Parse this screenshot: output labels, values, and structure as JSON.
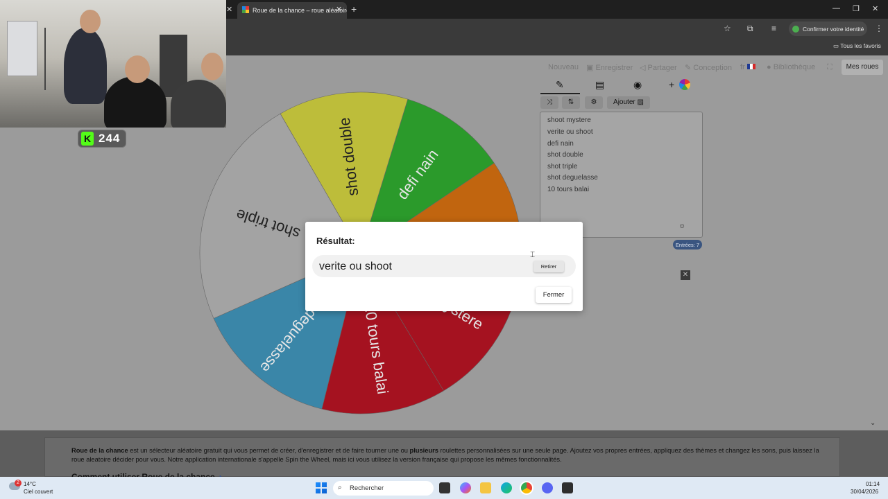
{
  "browser": {
    "tab_title": "Roue de la chance – roue aléatoire",
    "identity_button": "Confirmer votre identité",
    "bookmarks_label": "Tous les favoris"
  },
  "nav": {
    "new": "Nouveau",
    "save": "Enregistrer",
    "share": "Partager",
    "design": "Conception",
    "lang": "fr",
    "library": "Bibliothèque",
    "my_wheels": "Mes roues"
  },
  "editor": {
    "add_image_label": "Ajouter",
    "entries": [
      "shoot mystere",
      "verite ou shoot",
      "defi nain",
      "shot double",
      "shot triple",
      "shot deguelasse",
      "10 tours balai"
    ],
    "entries_count": "Entrées: 7"
  },
  "wheel": {
    "segments": [
      {
        "label": "shot double",
        "color": "#bdbd3a"
      },
      {
        "label": "defi nain",
        "color": "#2b9a2b"
      },
      {
        "label": "",
        "color": "#c1650f"
      },
      {
        "label": "hoot mystere",
        "color": "#a51220"
      },
      {
        "label": "10 tours balai",
        "color": "#a51220"
      },
      {
        "label": "shot deguelasse",
        "color": "#3a86a8"
      },
      {
        "label": "shot triple",
        "color": "#a3a3a3"
      }
    ]
  },
  "modal": {
    "title": "Résultat:",
    "result": "verite ou shoot",
    "remove_label": "Retirer",
    "close_label": "Fermer"
  },
  "stream": {
    "kick_count": "244"
  },
  "footer": {
    "brand": "Roue de la chance",
    "text_part1": " est un sélecteur aléatoire gratuit qui vous permet de créer, d'enregistrer et de faire tourner une ou ",
    "bold_word": "plusieurs",
    "text_part2": " roulettes personnalisées sur une seule page. Ajoutez vos propres entrées, appliquez des thèmes et changez les sons, puis laissez la roue aleatoire décider pour vous. Notre application internationale s'appelle Spin the Wheel, mais ici vous utilisez la version française qui propose les mêmes fonctionnalités.",
    "heading": "Comment utiliser Roue de la chance"
  },
  "taskbar": {
    "weather_badge": "2",
    "temperature": "14°C",
    "condition": "Ciel couvert",
    "search_placeholder": "Rechercher",
    "time": "01:14",
    "date": "30/04/2026"
  }
}
